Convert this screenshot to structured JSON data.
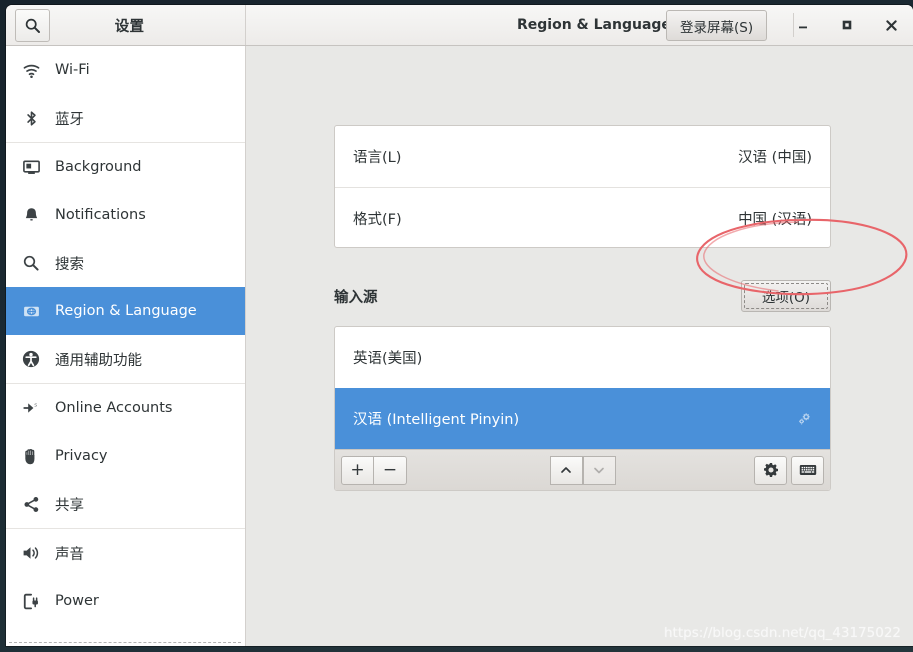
{
  "window": {
    "app_title": "设置",
    "panel_title": "Region & Language",
    "login_screen_button": "登录屏幕(S)",
    "search_icon": "search-icon",
    "minimize_icon": "minimize-icon",
    "maximize_icon": "maximize-icon",
    "close_icon": "close-icon"
  },
  "sidebar": {
    "items": [
      {
        "label": "Wi-Fi",
        "icon": "wifi-icon",
        "selected": false
      },
      {
        "label": "蓝牙",
        "icon": "bluetooth-icon",
        "selected": false
      },
      {
        "label": "Background",
        "icon": "background-icon",
        "selected": false
      },
      {
        "label": "Notifications",
        "icon": "bell-icon",
        "selected": false
      },
      {
        "label": "搜索",
        "icon": "search-icon",
        "selected": false
      },
      {
        "label": "Region & Language",
        "icon": "region-language-icon",
        "selected": true
      },
      {
        "label": "通用辅助功能",
        "icon": "accessibility-icon",
        "selected": false
      },
      {
        "label": "Online Accounts",
        "icon": "online-accounts-icon",
        "selected": false
      },
      {
        "label": "Privacy",
        "icon": "privacy-hand-icon",
        "selected": false
      },
      {
        "label": "共享",
        "icon": "sharing-icon",
        "selected": false
      },
      {
        "label": "声音",
        "icon": "sound-icon",
        "selected": false
      },
      {
        "label": "Power",
        "icon": "power-icon",
        "selected": false
      }
    ],
    "separators_after": [
      1,
      4,
      6,
      9
    ]
  },
  "content": {
    "language_rows": [
      {
        "label": "语言(L)",
        "value": "汉语 (中国)"
      },
      {
        "label": "格式(F)",
        "value": "中国 (汉语)"
      }
    ],
    "input_sources_heading": "输入源",
    "options_button": "选项(O)",
    "input_sources": [
      {
        "label": "英语(美国)",
        "active": false,
        "has_gear": false
      },
      {
        "label": "汉语 (Intelligent Pinyin)",
        "active": true,
        "has_gear": true
      }
    ],
    "toolbar": {
      "add_label": "+",
      "remove_label": "−",
      "move_up_icon": "chevron-up-icon",
      "move_down_icon": "chevron-down-icon",
      "move_down_disabled": true,
      "settings_icon": "gear-icon",
      "keyboard_icon": "keyboard-icon"
    }
  },
  "annotation": {
    "shape": "ellipse",
    "color": "#e8656a",
    "target": "选项(O)"
  },
  "watermark": {
    "text": "https://blog.csdn.net/qq_43175022"
  },
  "colors": {
    "selection_blue": "#4a90d9",
    "content_bg": "#e8e8e6",
    "headerbar_bg": "#edebe9",
    "desktop_bg": "#1e2d38",
    "annotation_red": "#e8656a"
  }
}
